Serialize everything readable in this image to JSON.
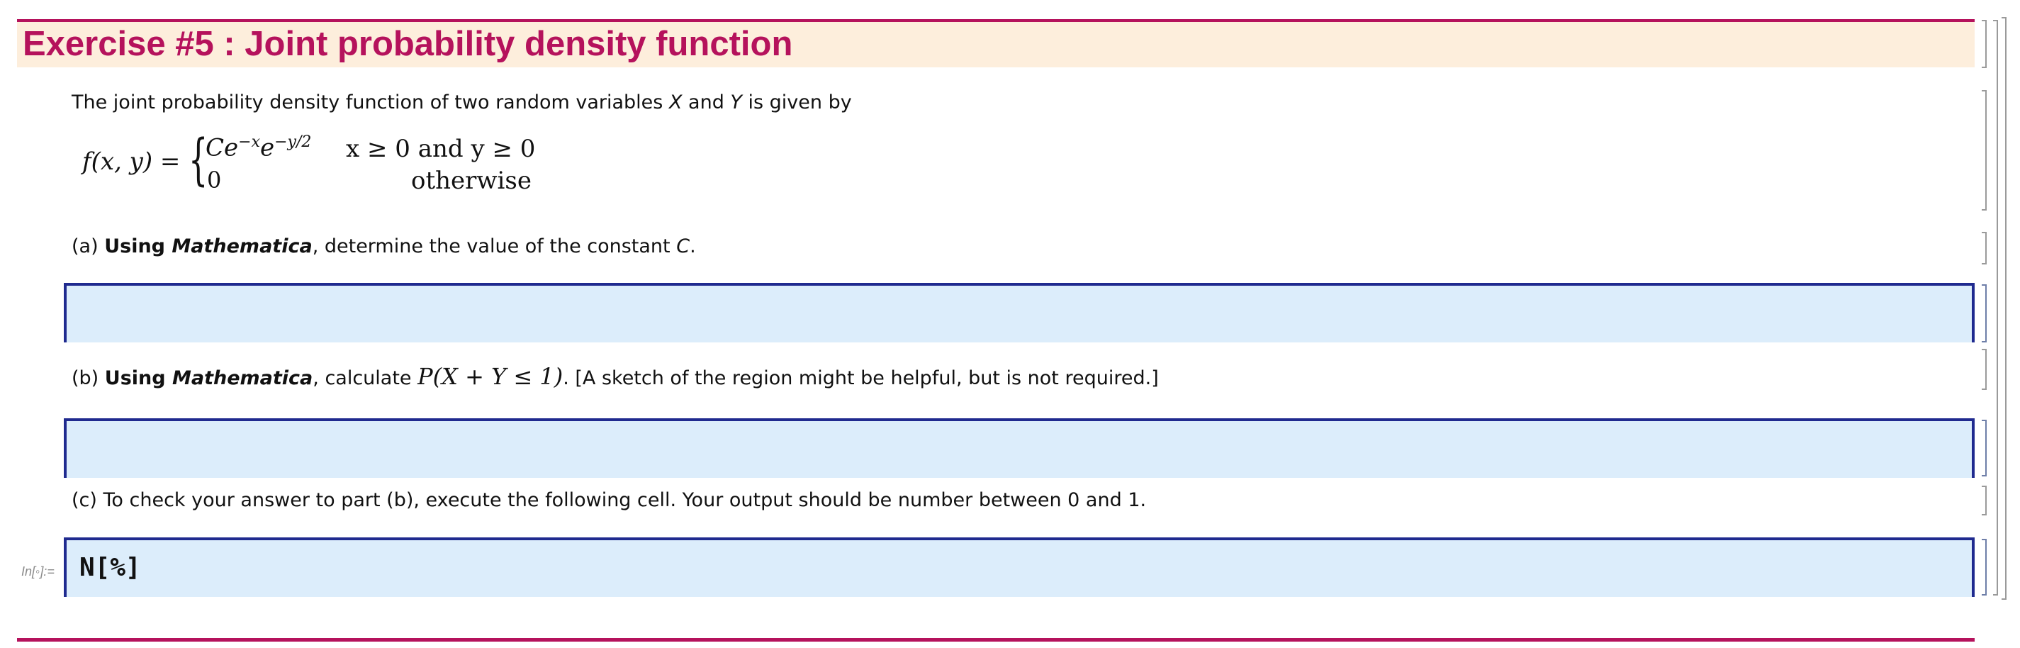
{
  "section": {
    "title": "Exercise #5 : Joint probability density function"
  },
  "intro": {
    "text_before": "The joint probability density function of two random variables ",
    "var_x": "X",
    "text_and": " and ",
    "var_y": "Y",
    "text_after": " is given by"
  },
  "formula": {
    "lhs": "f(x, y) = ",
    "brace": "{",
    "case1_c": "Ce",
    "case1_exp1": "−x",
    "case1_e": "e",
    "case1_exp2": "−y/2",
    "case1_condition": "x ≥ 0 and y ≥ 0",
    "case2_value": "0",
    "case2_condition": "otherwise"
  },
  "part_a": {
    "prefix": "(a) ",
    "bold_using": "Using ",
    "bold_italic_app": "Mathematica",
    "text": ", determine the value of the constant ",
    "constant": "C",
    "end": "."
  },
  "part_b": {
    "prefix": "(b) ",
    "bold_using": "Using ",
    "bold_italic_app": "Mathematica",
    "text": ", calculate ",
    "expression": "P(X + Y ≤ 1)",
    "after": ".  [A sketch of the region might be helpful, but is not required.]"
  },
  "part_c": {
    "text": "(c) To check your answer to part (b), execute the following cell.  Your output should be number between 0 and 1."
  },
  "input_cells": {
    "a_code": "",
    "b_code": "",
    "c_label": "In[◦]:=",
    "c_code": "N[%]"
  },
  "colors": {
    "section_title": "#b5125c",
    "section_background": "#fdeedc",
    "input_background": "#dcedfb",
    "input_border": "#1f2a8f"
  }
}
